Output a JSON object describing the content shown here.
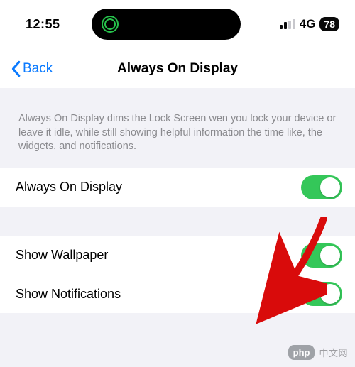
{
  "status": {
    "time": "12:55",
    "signal_bars_filled": 2,
    "network": "4G",
    "battery": "78"
  },
  "nav": {
    "back_label": "Back",
    "title": "Always On Display"
  },
  "description": "Always On Display dims the Lock Screen wen you lock your device or leave it idle, while still showing helpful information the time like, the widgets, and notifications.",
  "rows": {
    "aod": {
      "label": "Always On Display",
      "toggle_on": true
    },
    "wallpaper": {
      "label": "Show Wallpaper",
      "toggle_on": true
    },
    "notifications": {
      "label": "Show Notifications",
      "toggle_on": true
    }
  },
  "watermark": {
    "badge": "php",
    "text": "中文网"
  }
}
